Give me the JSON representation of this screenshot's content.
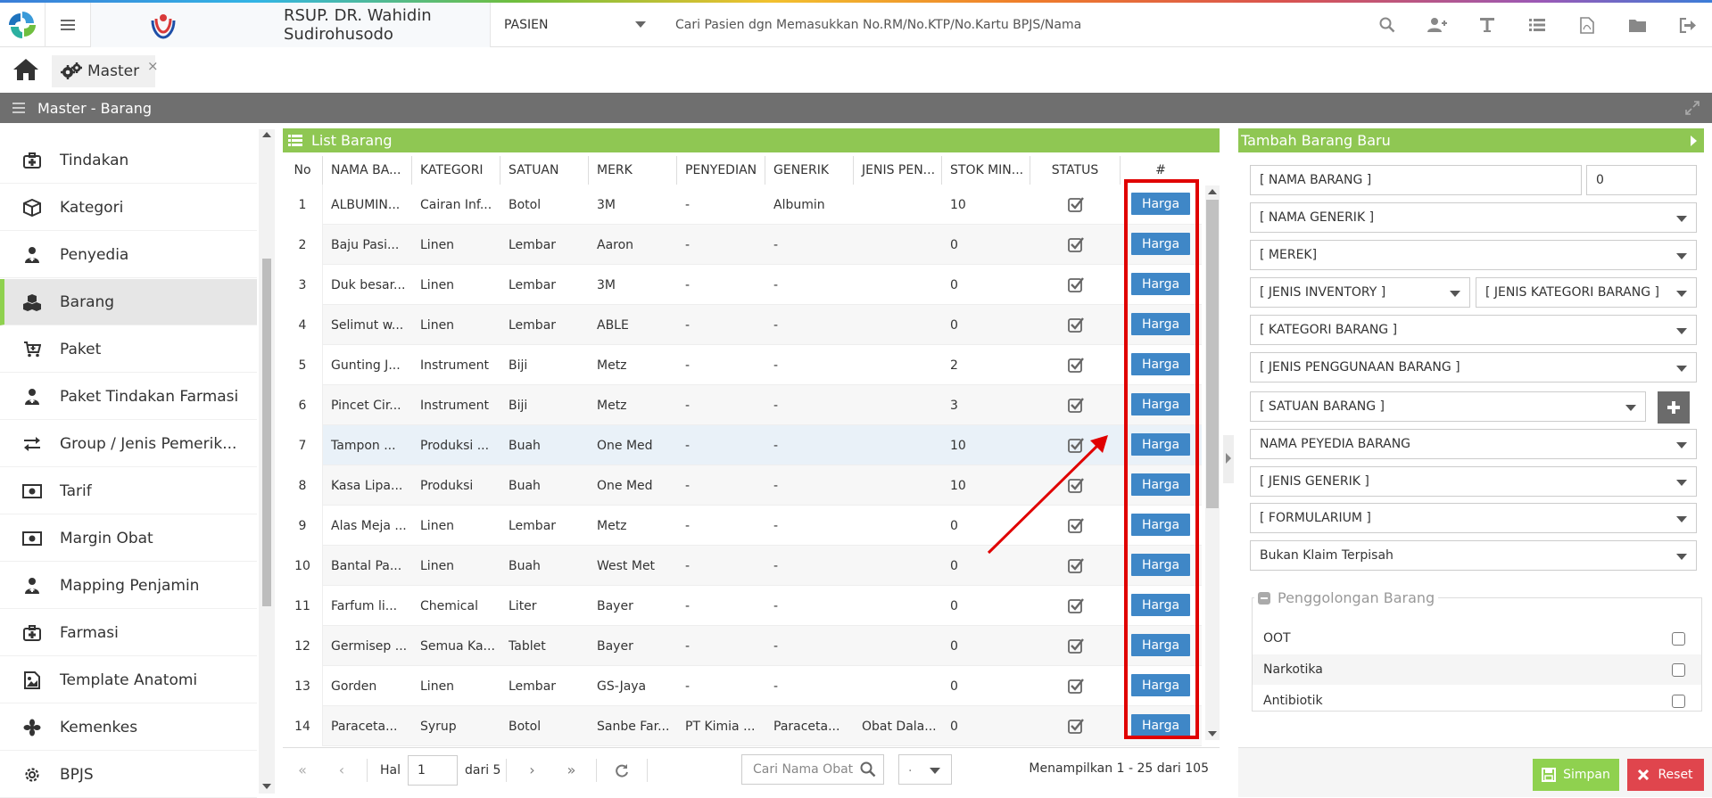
{
  "header": {
    "hospital_name": "RSUP. DR. Wahidin Sudirohusodo",
    "patient_select": "PASIEN",
    "search_hint": "Cari Pasien dgn Memasukkan No.RM/No.KTP/No.Kartu BPJS/Nama",
    "icons": [
      "search-icon",
      "add-user-icon",
      "text-icon",
      "list-icon",
      "pdf-icon",
      "folder-icon",
      "logout-icon"
    ]
  },
  "tabs": {
    "master_label": "Master",
    "close": "×"
  },
  "titlebar": {
    "title": "Master - Barang"
  },
  "sidebar": {
    "items": [
      {
        "label": "Tindakan",
        "icon": "medkit-icon"
      },
      {
        "label": "Kategori",
        "icon": "cube-icon"
      },
      {
        "label": "Penyedia",
        "icon": "user-md-icon"
      },
      {
        "label": "Barang",
        "icon": "cubes-icon"
      },
      {
        "label": "Paket",
        "icon": "cart-icon"
      },
      {
        "label": "Paket Tindakan Farmasi",
        "icon": "user-md-icon"
      },
      {
        "label": "Group / Jenis Pemerik...",
        "icon": "exchange-icon"
      },
      {
        "label": "Tarif",
        "icon": "money-icon"
      },
      {
        "label": "Margin Obat",
        "icon": "money-icon"
      },
      {
        "label": "Mapping Penjamin",
        "icon": "user-md-icon"
      },
      {
        "label": "Farmasi",
        "icon": "medkit-icon"
      },
      {
        "label": "Template Anatomi",
        "icon": "image-icon"
      },
      {
        "label": "Kemenkes",
        "icon": "fan-icon"
      },
      {
        "label": "BPJS",
        "icon": "gear-icon"
      }
    ],
    "active_index": 3
  },
  "list": {
    "title": "List Barang",
    "columns": [
      "No",
      "NAMA BA...",
      "KATEGORI",
      "SATUAN",
      "MERK",
      "PENYEDIAN",
      "GENERIK",
      "JENIS PEN...",
      "STOK MIN...",
      "STATUS",
      "#"
    ],
    "button_label": "Harga",
    "rows": [
      {
        "no": "1",
        "nama": "ALBUMIN...",
        "kategori": "Cairan Inf...",
        "satuan": "Botol",
        "merk": "3M",
        "penyedian": "-",
        "generik": "Albumin",
        "jenis": "",
        "stok": "10"
      },
      {
        "no": "2",
        "nama": "Baju Pasi...",
        "kategori": "Linen",
        "satuan": "Lembar",
        "merk": "Aaron",
        "penyedian": "-",
        "generik": "-",
        "jenis": "",
        "stok": "0"
      },
      {
        "no": "3",
        "nama": "Duk besar...",
        "kategori": "Linen",
        "satuan": "Lembar",
        "merk": "3M",
        "penyedian": "-",
        "generik": "-",
        "jenis": "",
        "stok": "0"
      },
      {
        "no": "4",
        "nama": "Selimut w...",
        "kategori": "Linen",
        "satuan": "Lembar",
        "merk": "ABLE",
        "penyedian": "-",
        "generik": "-",
        "jenis": "",
        "stok": "0"
      },
      {
        "no": "5",
        "nama": "Gunting J...",
        "kategori": "Instrument",
        "satuan": "Biji",
        "merk": "Metz",
        "penyedian": "-",
        "generik": "-",
        "jenis": "",
        "stok": "2"
      },
      {
        "no": "6",
        "nama": "Pincet Cir...",
        "kategori": "Instrument",
        "satuan": "Biji",
        "merk": "Metz",
        "penyedian": "-",
        "generik": "-",
        "jenis": "",
        "stok": "3"
      },
      {
        "no": "7",
        "nama": "Tampon ...",
        "kategori": "Produksi ...",
        "satuan": "Buah",
        "merk": "One Med",
        "penyedian": "-",
        "generik": "-",
        "jenis": "",
        "stok": "10"
      },
      {
        "no": "8",
        "nama": "Kasa Lipa...",
        "kategori": "Produksi",
        "satuan": "Buah",
        "merk": "One Med",
        "penyedian": "-",
        "generik": "-",
        "jenis": "",
        "stok": "10"
      },
      {
        "no": "9",
        "nama": "Alas Meja ...",
        "kategori": "Linen",
        "satuan": "Lembar",
        "merk": "Metz",
        "penyedian": "-",
        "generik": "-",
        "jenis": "",
        "stok": "0"
      },
      {
        "no": "10",
        "nama": "Bantal Pa...",
        "kategori": "Linen",
        "satuan": "Buah",
        "merk": "West Met",
        "penyedian": "-",
        "generik": "-",
        "jenis": "",
        "stok": "0"
      },
      {
        "no": "11",
        "nama": "Farfum li...",
        "kategori": "Chemical",
        "satuan": "Liter",
        "merk": "Bayer",
        "penyedian": "-",
        "generik": "-",
        "jenis": "",
        "stok": "0"
      },
      {
        "no": "12",
        "nama": "Germisep ...",
        "kategori": "Semua Ka...",
        "satuan": "Tablet",
        "merk": "Bayer",
        "penyedian": "-",
        "generik": "-",
        "jenis": "",
        "stok": "0"
      },
      {
        "no": "13",
        "nama": "Gorden",
        "kategori": "Linen",
        "satuan": "Lembar",
        "merk": "GS-Jaya",
        "penyedian": "-",
        "generik": "-",
        "jenis": "",
        "stok": "0"
      },
      {
        "no": "14",
        "nama": "Paraceta...",
        "kategori": "Syrup",
        "satuan": "Botol",
        "merk": "Sanbe Far...",
        "penyedian": "PT Kimia ...",
        "generik": "Paraceta...",
        "jenis": "Obat Dala...",
        "stok": "0"
      }
    ]
  },
  "pager": {
    "hal_label": "Hal",
    "page": "1",
    "of_label": "dari 5",
    "search_placeholder": "Cari Nama Obat",
    "page_size": ".",
    "info": "Menampilkan 1 - 25 dari 105"
  },
  "form": {
    "title": "Tambah Barang Baru",
    "nama_barang": "[ NAMA BARANG ]",
    "nama_barang_num": "0",
    "nama_generik": "[ NAMA GENERIK ]",
    "merek": "[ MEREK]",
    "jenis_inventory": "[ JENIS INVENTORY ]",
    "jenis_kategori": "[ JENIS KATEGORI BARANG ]",
    "kategori_barang": "[ KATEGORI BARANG ]",
    "jenis_penggunaan": "[ JENIS PENGGUNAAN BARANG ]",
    "satuan_barang": "[ SATUAN BARANG ]",
    "nama_penyedia": "NAMA PEYEDIA BARANG",
    "jenis_generik": "[ JENIS GENERIK ]",
    "formularium": "[ FORMULARIUM ]",
    "klaim": "Bukan Klaim Terpisah",
    "penggolongan_title": "Penggolongan Barang",
    "penggolongan": [
      "OOT",
      "Narkotika",
      "Antibiotik"
    ],
    "simpan": "Simpan",
    "reset": "Reset"
  },
  "colors": {
    "accent_green": "#8fc753",
    "button_blue": "#3f87c7",
    "highlight_red": "#e00000",
    "reset_red": "#e0454d",
    "titlebar_gray": "#6f6f6f"
  }
}
